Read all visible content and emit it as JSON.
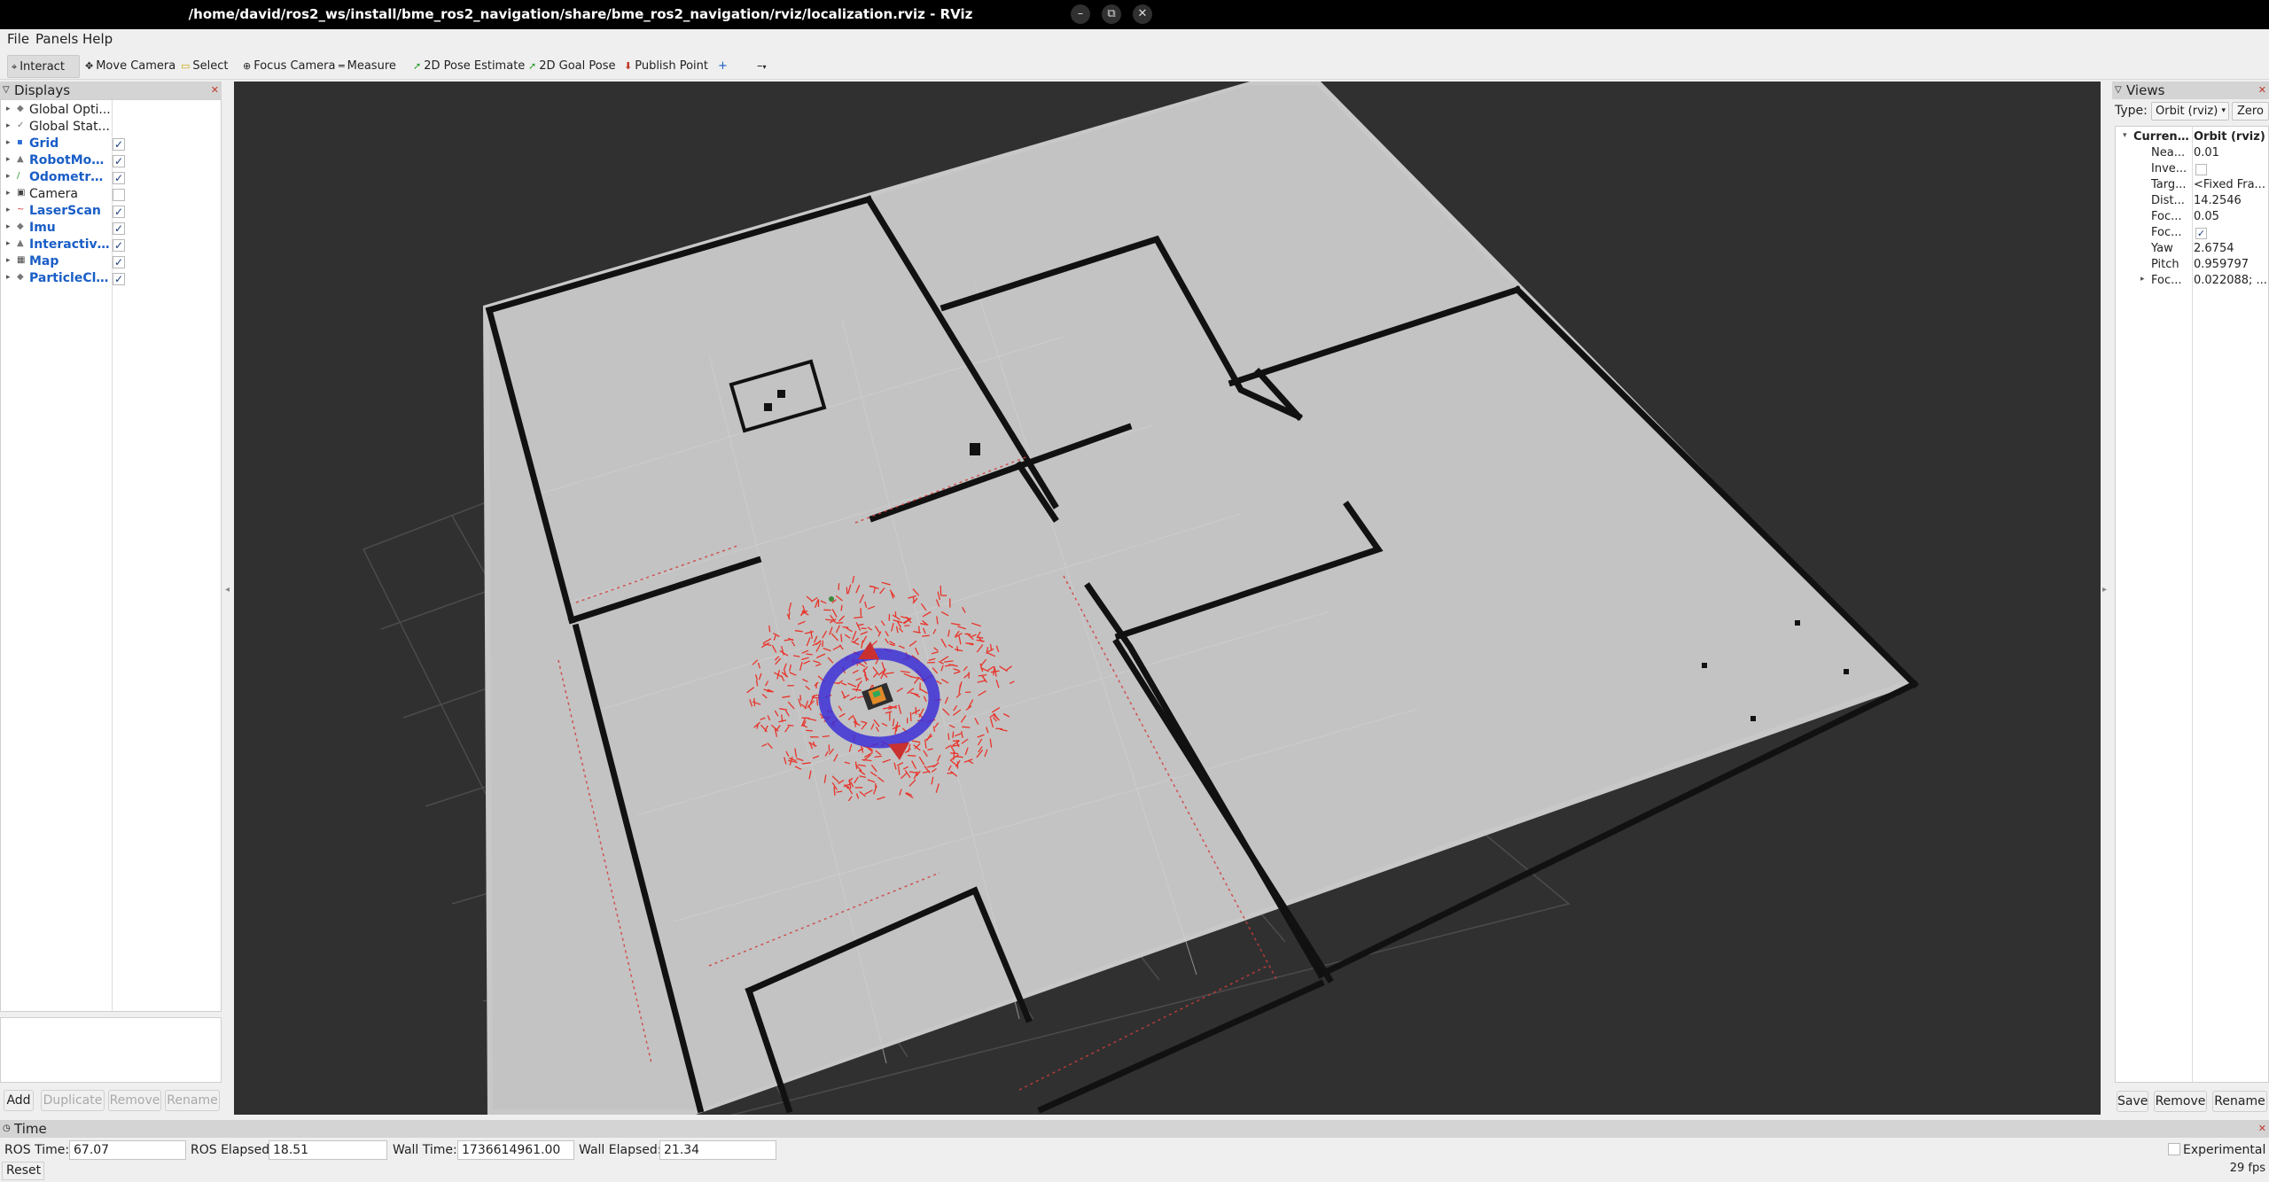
{
  "window": {
    "title": "/home/david/ros2_ws/install/bme_ros2_navigation/share/bme_ros2_navigation/rviz/localization.rviz - RViz",
    "controls": [
      "–",
      "⧉",
      "✕"
    ]
  },
  "menu": [
    "File",
    "Panels",
    "Help"
  ],
  "toolbar": {
    "interact": "Interact",
    "move_camera": "Move Camera",
    "select": "Select",
    "focus_camera": "Focus Camera",
    "measure": "Measure",
    "pose_estimate": "2D Pose Estimate",
    "goal_pose": "2D Goal Pose",
    "publish_point": "Publish Point",
    "plus": "+",
    "more": "–"
  },
  "displays": {
    "title": "Displays",
    "items": [
      {
        "label": "Global Opti...",
        "enabled": false,
        "checkbox": null
      },
      {
        "label": "Global Stat...",
        "enabled": false,
        "checkbox": null
      },
      {
        "label": "Grid",
        "enabled": true,
        "checkbox": "✓"
      },
      {
        "label": "RobotModel",
        "enabled": true,
        "checkbox": "✓"
      },
      {
        "label": "Odometry ...",
        "enabled": true,
        "checkbox": "✓"
      },
      {
        "label": "Camera",
        "enabled": false,
        "checkbox": ""
      },
      {
        "label": "LaserScan",
        "enabled": true,
        "checkbox": "✓"
      },
      {
        "label": "Imu",
        "enabled": true,
        "checkbox": "✓"
      },
      {
        "label": "Interactive...",
        "enabled": true,
        "checkbox": "✓"
      },
      {
        "label": "Map",
        "enabled": true,
        "checkbox": "✓"
      },
      {
        "label": "ParticleClo...",
        "enabled": true,
        "checkbox": "✓"
      }
    ],
    "buttons": {
      "add": "Add",
      "duplicate": "Duplicate",
      "remove": "Remove",
      "rename": "Rename"
    }
  },
  "views": {
    "title": "Views",
    "type_label": "Type:",
    "type_value": "Orbit (rviz)",
    "zero": "Zero",
    "current_key": "Curren...",
    "current_value": "Orbit (rviz)",
    "props": [
      {
        "k": "Nea...",
        "v": "0.01"
      },
      {
        "k": "Inve...",
        "v": "",
        "check": ""
      },
      {
        "k": "Targ...",
        "v": "<Fixed Fra..."
      },
      {
        "k": "Dist...",
        "v": "14.2546"
      },
      {
        "k": "Foc...",
        "v": "0.05"
      },
      {
        "k": "Foc...",
        "v": "",
        "check": "✓"
      },
      {
        "k": "Yaw",
        "v": "2.6754"
      },
      {
        "k": "Pitch",
        "v": "0.959797"
      },
      {
        "k": "Foc...",
        "v": "0.022088; ...",
        "expandable": true
      }
    ],
    "buttons": {
      "save": "Save",
      "remove": "Remove",
      "rename": "Rename"
    }
  },
  "time": {
    "title": "Time",
    "ros_time_label": "ROS Time:",
    "ros_time": "67.07",
    "ros_elapsed_label": "ROS Elapsed:",
    "ros_elapsed": "18.51",
    "wall_time_label": "Wall Time:",
    "wall_time": "1736614961.00",
    "wall_elapsed_label": "Wall Elapsed:",
    "wall_elapsed": "21.34",
    "experimental": "Experimental",
    "reset": "Reset",
    "fps": "29 fps"
  },
  "colors": {
    "map_free": "#c6c6c6",
    "map_outer": "#c8c8c8",
    "wall": "#111111",
    "viewport_bg": "#303030",
    "particles": "#e8342a",
    "ring": "#3d2fd6",
    "enabled_display": "#1a5ec7"
  }
}
